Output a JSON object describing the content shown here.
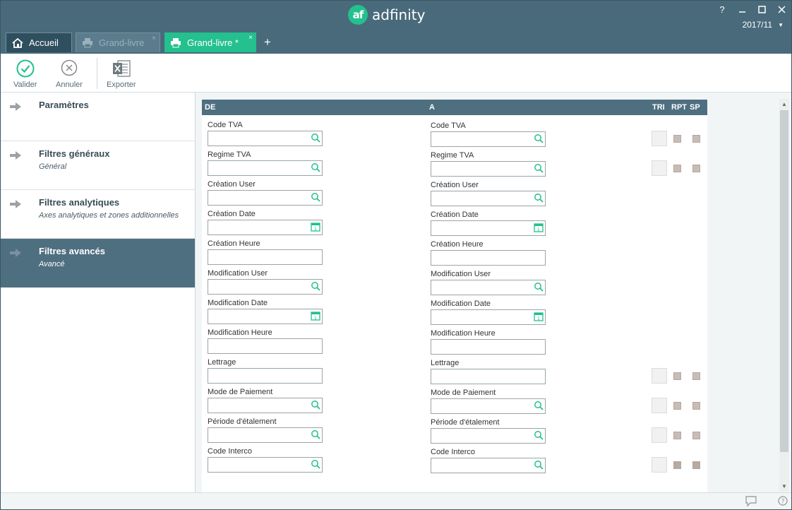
{
  "app": {
    "name": "adfinity",
    "logo_text": "af",
    "period": "2017/11"
  },
  "window_controls": {
    "help": "?"
  },
  "tabs": [
    {
      "label": "Accueil",
      "icon": "home-icon",
      "active": false
    },
    {
      "label": "Grand-livre",
      "icon": "printer-icon",
      "active": false,
      "close": "×"
    },
    {
      "label": "Grand-livre *",
      "icon": "printer-icon",
      "active": true,
      "close": "×"
    }
  ],
  "tab_add": "+",
  "toolbar": {
    "validate_label": "Valider",
    "cancel_label": "Annuler",
    "export_label": "Exporter"
  },
  "sidebar": {
    "items": [
      {
        "title": "Paramètres",
        "subtitle": ""
      },
      {
        "title": "Filtres généraux",
        "subtitle": "Général"
      },
      {
        "title": "Filtres analytiques",
        "subtitle": "Axes analytiques et zones additionnelles"
      },
      {
        "title": "Filtres avancés",
        "subtitle": "Avancé",
        "active": true
      }
    ]
  },
  "panel": {
    "headers": {
      "from": "DE",
      "to": "A",
      "tri": "TRI",
      "rpt": "RPT",
      "sp": "SP"
    },
    "fields": [
      {
        "label": "Code TVA",
        "from_value": "",
        "to_value": "",
        "icon": "search-icon"
      },
      {
        "label": "Regime TVA",
        "from_value": "",
        "to_value": "",
        "icon": "search-icon"
      },
      {
        "label": "Création User",
        "from_value": "",
        "to_value": "",
        "icon": "search-icon"
      },
      {
        "label": "Création Date",
        "from_value": "",
        "to_value": "",
        "icon": "calendar-icon"
      },
      {
        "label": "Création Heure",
        "from_value": "",
        "to_value": "",
        "icon": ""
      },
      {
        "label": "Modification User",
        "from_value": "",
        "to_value": "",
        "icon": "search-icon"
      },
      {
        "label": "Modification Date",
        "from_value": "",
        "to_value": "",
        "icon": "calendar-icon"
      },
      {
        "label": "Modification Heure",
        "from_value": "",
        "to_value": "",
        "icon": ""
      },
      {
        "label": "Lettrage",
        "from_value": "",
        "to_value": "",
        "icon": ""
      },
      {
        "label": "Mode de Paiement",
        "from_value": "",
        "to_value": "",
        "icon": "search-icon"
      },
      {
        "label": "Période d'étalement",
        "from_value": "",
        "to_value": "",
        "icon": "search-icon"
      },
      {
        "label": "Code Interco",
        "from_value": "",
        "to_value": "",
        "icon": "search-icon"
      }
    ]
  },
  "colors": {
    "titlebar": "#496a7b",
    "accent": "#24c08e",
    "active_sidebar": "#4e6f80"
  }
}
